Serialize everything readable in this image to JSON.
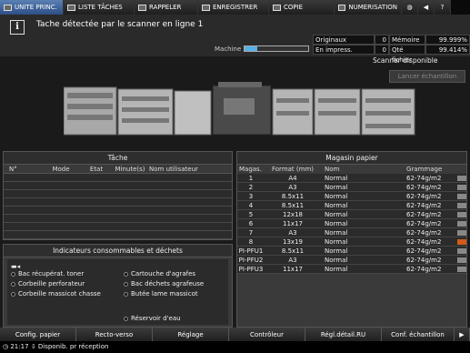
{
  "tabs": [
    {
      "label": "UNITE PRINC."
    },
    {
      "label": "LISTE TÂCHES"
    },
    {
      "label": "RAPPELER"
    },
    {
      "label": "ENREGISTRER"
    },
    {
      "label": "COPIE"
    },
    {
      "label": "NUMERISATION"
    }
  ],
  "message": "Tache détectée par le scanner en ligne 1",
  "machine": {
    "label": "Machine",
    "level": 0.2
  },
  "counters": {
    "originaux_label": "Originaux",
    "originaux_value": "0",
    "memoire_label": "Mémoire",
    "memoire_value": "99.999%",
    "en_impress_label": "En impress.",
    "en_impress_value": "0",
    "qte_fichier_label": "Qté fichier",
    "qte_fichier_value": "99.414%"
  },
  "scanner_status": "Scanner disponible",
  "launch_button": "Lancer échantillon",
  "tache": {
    "title": "Tâche",
    "columns": [
      "N°",
      "Mode",
      "Etat",
      "Minute(s)",
      "Nom utilisateur"
    ]
  },
  "consommables": {
    "title": "Indicateurs consommables et déchets",
    "items": [
      "Bac récupérat. toner",
      "Corbeille perforateur",
      "Corbeille massicot chasse",
      "Cartouche d'agrafes",
      "Bac déchets agrafeuse",
      "Butée lame massicot",
      "Réservoir d'eau"
    ]
  },
  "magasin": {
    "title": "Magasin papier",
    "columns": [
      "Magas.",
      "Format (mm)",
      "Nom",
      "Grammage"
    ],
    "rows": [
      {
        "magas": "1",
        "format": "A4",
        "nom": "Normal",
        "grammage": "62-74g/m2"
      },
      {
        "magas": "2",
        "format": "A3",
        "nom": "Normal",
        "grammage": "62-74g/m2"
      },
      {
        "magas": "3",
        "format": "8.5x11",
        "nom": "Normal",
        "grammage": "62-74g/m2"
      },
      {
        "magas": "4",
        "format": "8.5x11",
        "nom": "Normal",
        "grammage": "62-74g/m2"
      },
      {
        "magas": "5",
        "format": "12x18",
        "nom": "Normal",
        "grammage": "62-74g/m2"
      },
      {
        "magas": "6",
        "format": "11x17",
        "nom": "Normal",
        "grammage": "62-74g/m2"
      },
      {
        "magas": "7",
        "format": "A3",
        "nom": "Normal",
        "grammage": "62-74g/m2"
      },
      {
        "magas": "8",
        "format": "13x19",
        "nom": "Normal",
        "grammage": "62-74g/m2"
      },
      {
        "magas": "PI-PFU1",
        "format": "8.5x11",
        "nom": "Normal",
        "grammage": "62-74g/m2"
      },
      {
        "magas": "PI-PFU2",
        "format": "A3",
        "nom": "Normal",
        "grammage": "62-74g/m2"
      },
      {
        "magas": "PI-PFU3",
        "format": "11x17",
        "nom": "Normal",
        "grammage": "62-74g/m2"
      }
    ]
  },
  "bottom_buttons": [
    {
      "label": "Config. papier"
    },
    {
      "label": "Recto-verso"
    },
    {
      "label": "Réglage"
    },
    {
      "label": "Contrôleur"
    },
    {
      "label": "Régl.détail.RU"
    },
    {
      "label": "Conf. échantillon"
    }
  ],
  "status": {
    "time": "21:17",
    "text": "Disponib. pr réception"
  },
  "colors": {
    "active_tab": "#2c4f86",
    "machine_level": "#58b0e8",
    "level_low": "#d25a1b"
  }
}
